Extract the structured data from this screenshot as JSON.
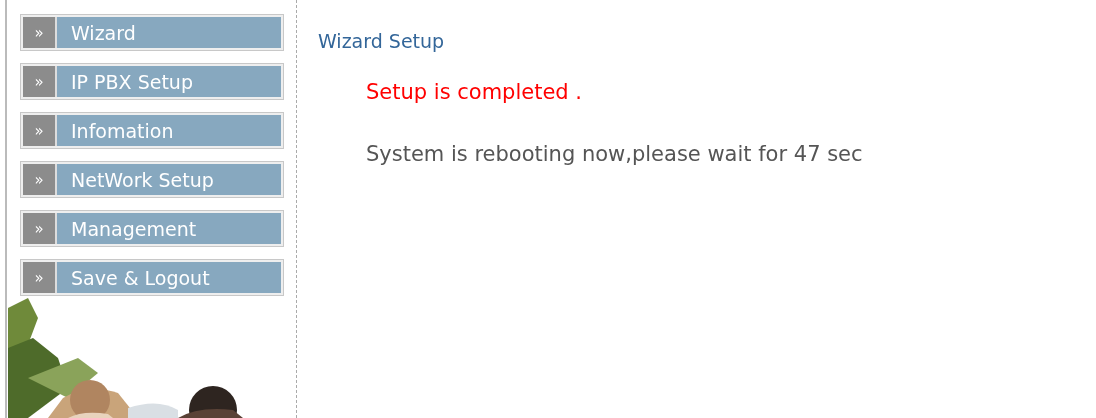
{
  "sidebar": {
    "items": [
      {
        "marker": "»",
        "label": "Wizard"
      },
      {
        "marker": "»",
        "label": "IP PBX Setup"
      },
      {
        "marker": "»",
        "label": "Infomation"
      },
      {
        "marker": "»",
        "label": "NetWork Setup"
      },
      {
        "marker": "»",
        "label": "Management"
      },
      {
        "marker": "»",
        "label": "Save & Logout"
      }
    ]
  },
  "content": {
    "title": "Wizard Setup",
    "status": "Setup is completed .",
    "message": "System is rebooting now,please wait for 47 sec"
  }
}
